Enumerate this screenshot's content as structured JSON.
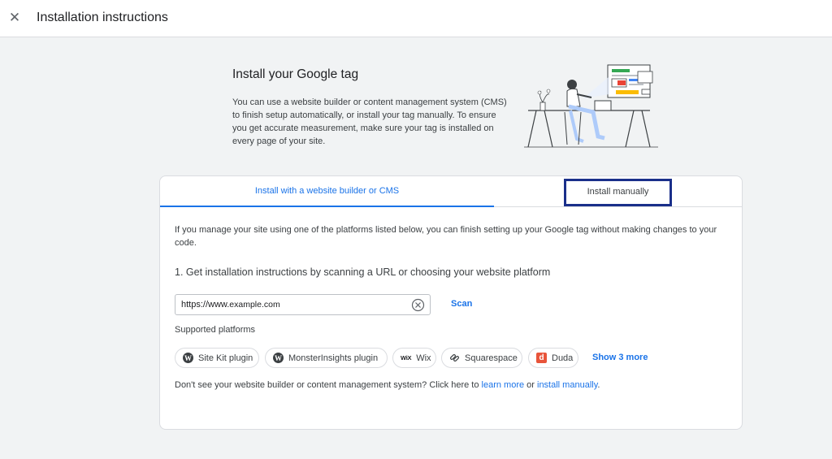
{
  "header": {
    "title": "Installation instructions",
    "close_icon": "close-icon"
  },
  "hero": {
    "title": "Install your Google tag",
    "description": "You can use a website builder or content management system (CMS) to finish setup automatically, or install your tag manually. To ensure you get accurate measurement, make sure your tag is installed on every page of your site."
  },
  "tabs": [
    {
      "label": "Install with a website builder or CMS",
      "active": true
    },
    {
      "label": "Install manually",
      "active": false
    }
  ],
  "content": {
    "intro": "If you manage your site using one of the platforms listed below, you can finish setting up your Google tag without making changes to your code.",
    "step1": "1. Get installation instructions by scanning a URL or choosing your website platform",
    "url_input": {
      "value_prefix": "https://www.",
      "value_rest": "example.com",
      "clear_icon": "clear-icon"
    },
    "scan_label": "Scan",
    "supported_label": "Supported platforms",
    "platforms": [
      {
        "label": "Site Kit plugin",
        "icon": "wordpress-icon"
      },
      {
        "label": "MonsterInsights plugin",
        "icon": "wordpress-icon"
      },
      {
        "label": "Wix",
        "icon": "wix-icon",
        "icon_text": "WiX"
      },
      {
        "label": "Squarespace",
        "icon": "squarespace-icon"
      },
      {
        "label": "Duda",
        "icon": "duda-icon",
        "icon_text": "d"
      }
    ],
    "show_more": "Show 3 more",
    "footer": {
      "text_before": "Don't see your website builder or content management system? Click here to ",
      "learn_more": "learn more",
      "text_middle": " or ",
      "install_manually": "install manually",
      "text_end": "."
    }
  },
  "colors": {
    "accent": "#1a73e8",
    "highlight_box": "#1a2f8a",
    "background": "#f1f3f4",
    "duda": "#e8543a"
  }
}
